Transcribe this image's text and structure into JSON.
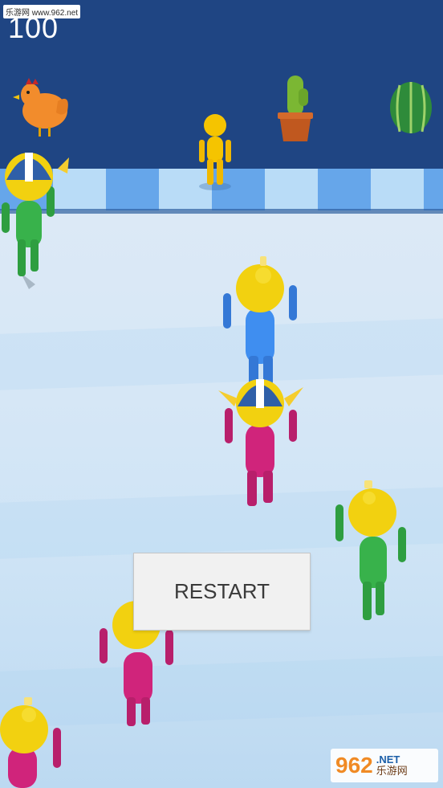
{
  "watermark_top": "乐游网 www.962.net",
  "score": "100",
  "restart_label": "RESTART",
  "watermark_logo": {
    "mark": "962",
    "suffix": ".NET",
    "subtitle": "乐游网"
  },
  "colors": {
    "sky": "#1f4583",
    "ledge_dark": "#66a6ea",
    "ledge_light": "#b9dcf7",
    "floor": "#d6e7f6",
    "helmet_yellow": "#f2d110",
    "helmet_blue": "#2f5fa8",
    "runner_blue": "#3f8ef0",
    "runner_pink": "#d0247b",
    "runner_green": "#38b24b"
  },
  "items": [
    "chicken",
    "target-figure",
    "cactus-pot",
    "watermelon"
  ],
  "runners": [
    {
      "color": "green",
      "helmet": "viking-blue"
    },
    {
      "color": "blue",
      "helmet": "yellow"
    },
    {
      "color": "pink",
      "helmet": "viking-blue"
    },
    {
      "color": "green",
      "helmet": "yellow"
    },
    {
      "color": "pink",
      "helmet": "yellow"
    },
    {
      "color": "pink",
      "helmet": "yellow"
    }
  ]
}
